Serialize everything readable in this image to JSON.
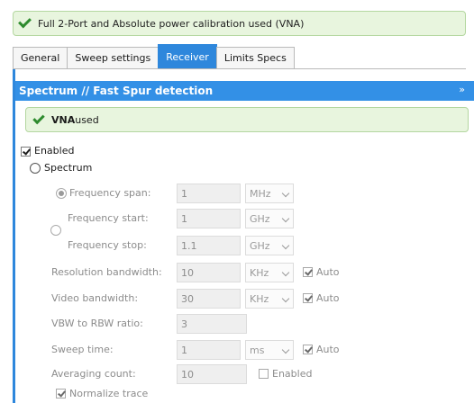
{
  "banner": {
    "text": "Full 2-Port and Absolute power calibration used (VNA)"
  },
  "tabs": [
    {
      "label": "General"
    },
    {
      "label": "Sweep settings"
    },
    {
      "label": "Receiver"
    },
    {
      "label": "Limits Specs"
    }
  ],
  "active_tab": "Receiver",
  "section": {
    "title": "Spectrum // Fast Spur detection",
    "chevron": "»"
  },
  "vna_notice": {
    "bold": "VNA",
    "rest": " used"
  },
  "enabled": {
    "label": "Enabled",
    "checked": true
  },
  "spectrum": {
    "label": "Spectrum",
    "selected": false
  },
  "frequency_span": {
    "label": "Frequency span:",
    "value": "1",
    "unit": "MHz",
    "selected": true
  },
  "frequency_start": {
    "label": "Frequency start:",
    "value": "1",
    "unit": "GHz"
  },
  "frequency_stop": {
    "label": "Frequency stop:",
    "value": "1.1",
    "unit": "GHz"
  },
  "resolution_bandwidth": {
    "label": "Resolution bandwidth:",
    "value": "10",
    "unit": "KHz",
    "auto_label": "Auto",
    "auto": true
  },
  "video_bandwidth": {
    "label": "Video bandwidth:",
    "value": "30",
    "unit": "KHz",
    "auto_label": "Auto",
    "auto": true
  },
  "vbw_rbw_ratio": {
    "label": "VBW to RBW ratio:",
    "value": "3"
  },
  "sweep_time": {
    "label": "Sweep time:",
    "value": "1",
    "unit": "ms",
    "auto_label": "Auto",
    "auto": true
  },
  "averaging_count": {
    "label": "Averaging count:",
    "value": "10",
    "enabled_label": "Enabled",
    "enabled": false
  },
  "normalize_trace": {
    "label": "Normalize trace",
    "checked": true
  },
  "colors": {
    "accent": "#2e87dc",
    "success_bg": "#e8f5de",
    "success_check": "#2e8b2e"
  }
}
